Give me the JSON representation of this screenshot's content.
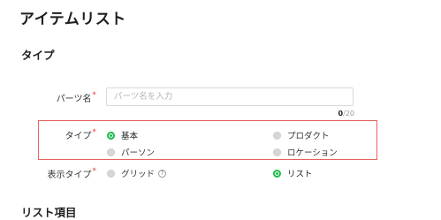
{
  "page": {
    "title": "アイテムリスト"
  },
  "sections": {
    "type_title": "タイプ",
    "list_title": "リスト項目"
  },
  "fields": {
    "parts_name": {
      "label": "パーツ名",
      "required_mark": "*",
      "placeholder": "パーツ名を入力",
      "value": "",
      "counter_current": "0",
      "counter_max": "/20"
    },
    "type": {
      "label": "タイプ",
      "required_mark": "*",
      "options": [
        {
          "label": "基本",
          "selected": true
        },
        {
          "label": "プロダクト",
          "selected": false
        },
        {
          "label": "パーソン",
          "selected": false
        },
        {
          "label": "ロケーション",
          "selected": false
        }
      ]
    },
    "display_type": {
      "label": "表示タイプ",
      "required_mark": "*",
      "options": [
        {
          "label": "グリッド",
          "selected": false
        },
        {
          "label": "リスト",
          "selected": true
        }
      ],
      "help_icon": "?"
    }
  },
  "colors": {
    "accent": "#1fbb4a",
    "required": "#e03a3a",
    "highlight_border": "#e8625d"
  },
  "icons": {
    "help": "question-circle-icon"
  }
}
